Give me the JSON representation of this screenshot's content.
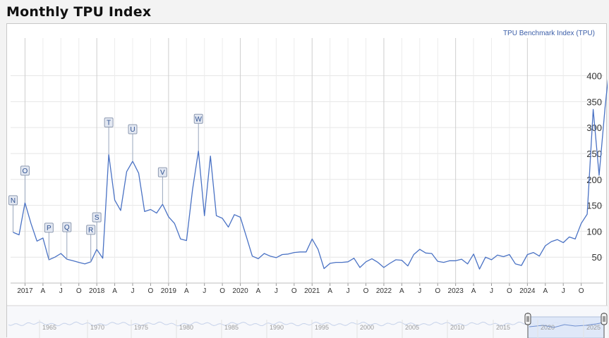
{
  "title": "Monthly TPU Index",
  "chart_data": {
    "type": "line",
    "series": [
      {
        "name": "TPU Benchmark Index (TPU)",
        "color": "#4a72c4",
        "x": [
          "2016-11",
          "2016-12",
          "2017-01",
          "2017-02",
          "2017-03",
          "2017-04",
          "2017-05",
          "2017-06",
          "2017-07",
          "2017-08",
          "2017-09",
          "2017-10",
          "2017-11",
          "2017-12",
          "2018-01",
          "2018-02",
          "2018-03",
          "2018-04",
          "2018-05",
          "2018-06",
          "2018-07",
          "2018-08",
          "2018-09",
          "2018-10",
          "2018-11",
          "2018-12",
          "2019-01",
          "2019-02",
          "2019-03",
          "2019-04",
          "2019-05",
          "2019-06",
          "2019-07",
          "2019-08",
          "2019-09",
          "2019-10",
          "2019-11",
          "2019-12",
          "2020-01",
          "2020-02",
          "2020-03",
          "2020-04",
          "2020-05",
          "2020-06",
          "2020-07",
          "2020-08",
          "2020-09",
          "2020-10",
          "2020-11",
          "2020-12",
          "2021-01",
          "2021-02",
          "2021-03",
          "2021-04",
          "2021-05",
          "2021-06",
          "2021-07",
          "2021-08",
          "2021-09",
          "2021-10",
          "2021-11",
          "2021-12",
          "2022-01",
          "2022-02",
          "2022-03",
          "2022-04",
          "2022-05",
          "2022-06",
          "2022-07",
          "2022-08",
          "2022-09",
          "2022-10",
          "2022-11",
          "2022-12",
          "2023-01",
          "2023-02",
          "2023-03",
          "2023-04",
          "2023-05",
          "2023-06",
          "2023-07",
          "2023-08",
          "2023-09",
          "2023-10",
          "2023-11",
          "2023-12",
          "2024-01",
          "2024-02",
          "2024-03",
          "2024-04",
          "2024-05",
          "2024-06",
          "2024-07",
          "2024-08",
          "2024-09",
          "2024-10",
          "2024-11",
          "2024-12",
          "2025-01",
          "2025-02",
          "2025-03"
        ],
        "values": [
          98,
          93,
          155,
          115,
          81,
          87,
          45,
          50,
          57,
          46,
          43,
          40,
          37,
          41,
          65,
          48,
          248,
          160,
          140,
          215,
          235,
          212,
          138,
          142,
          135,
          152,
          128,
          115,
          85,
          82,
          180,
          255,
          130,
          245,
          130,
          125,
          108,
          132,
          127,
          90,
          52,
          47,
          57,
          52,
          49,
          55,
          56,
          59,
          60,
          60,
          85,
          65,
          28,
          38,
          40,
          40,
          41,
          48,
          30,
          41,
          47,
          40,
          30,
          38,
          45,
          44,
          33,
          55,
          65,
          58,
          57,
          42,
          40,
          43,
          43,
          46,
          37,
          56,
          27,
          50,
          45,
          54,
          51,
          55,
          37,
          34,
          55,
          59,
          52,
          72,
          80,
          84,
          78,
          89,
          85,
          115,
          133,
          335,
          208,
          340,
          450
        ]
      }
    ],
    "ylim": [
      0,
      470
    ],
    "yticks": [
      50,
      100,
      150,
      200,
      250,
      300,
      350,
      400
    ],
    "xtick_labels": [
      {
        "x": "2017-01",
        "label": "2017"
      },
      {
        "x": "2017-04",
        "label": "A"
      },
      {
        "x": "2017-07",
        "label": "J"
      },
      {
        "x": "2017-10",
        "label": "O"
      },
      {
        "x": "2018-01",
        "label": "2018"
      },
      {
        "x": "2018-04",
        "label": "A"
      },
      {
        "x": "2018-07",
        "label": "J"
      },
      {
        "x": "2018-10",
        "label": "O"
      },
      {
        "x": "2019-01",
        "label": "2019"
      },
      {
        "x": "2019-04",
        "label": "A"
      },
      {
        "x": "2019-07",
        "label": "J"
      },
      {
        "x": "2019-10",
        "label": "O"
      },
      {
        "x": "2020-01",
        "label": "2020"
      },
      {
        "x": "2020-04",
        "label": "A"
      },
      {
        "x": "2020-07",
        "label": "J"
      },
      {
        "x": "2020-10",
        "label": "O"
      },
      {
        "x": "2021-01",
        "label": "2021"
      },
      {
        "x": "2021-04",
        "label": "A"
      },
      {
        "x": "2021-07",
        "label": "J"
      },
      {
        "x": "2021-10",
        "label": "O"
      },
      {
        "x": "2022-01",
        "label": "2022"
      },
      {
        "x": "2022-04",
        "label": "A"
      },
      {
        "x": "2022-07",
        "label": "J"
      },
      {
        "x": "2022-10",
        "label": "O"
      },
      {
        "x": "2023-01",
        "label": "2023"
      },
      {
        "x": "2023-04",
        "label": "A"
      },
      {
        "x": "2023-07",
        "label": "J"
      },
      {
        "x": "2023-10",
        "label": "O"
      },
      {
        "x": "2024-01",
        "label": "2024"
      },
      {
        "x": "2024-04",
        "label": "A"
      },
      {
        "x": "2024-07",
        "label": "J"
      },
      {
        "x": "2024-10",
        "label": "O"
      }
    ],
    "flags": [
      {
        "label": "N",
        "x": "2016-11"
      },
      {
        "label": "O",
        "x": "2017-01"
      },
      {
        "label": "P",
        "x": "2017-05"
      },
      {
        "label": "Q",
        "x": "2017-08"
      },
      {
        "label": "R",
        "x": "2017-12"
      },
      {
        "label": "S",
        "x": "2018-01"
      },
      {
        "label": "T",
        "x": "2018-03"
      },
      {
        "label": "U",
        "x": "2018-07"
      },
      {
        "label": "V",
        "x": "2018-12"
      },
      {
        "label": "W",
        "x": "2019-06"
      }
    ],
    "legend": {
      "position": "top-right",
      "label": "TPU Benchmark Index (TPU)"
    },
    "grid": true,
    "navigator": {
      "labels": [
        "1965",
        "1970",
        "1975",
        "1980",
        "1985",
        "1990",
        "1995",
        "2000",
        "2005",
        "2010",
        "2015",
        "2020",
        "2025"
      ],
      "selected_range": [
        "2020",
        "2025"
      ]
    }
  }
}
